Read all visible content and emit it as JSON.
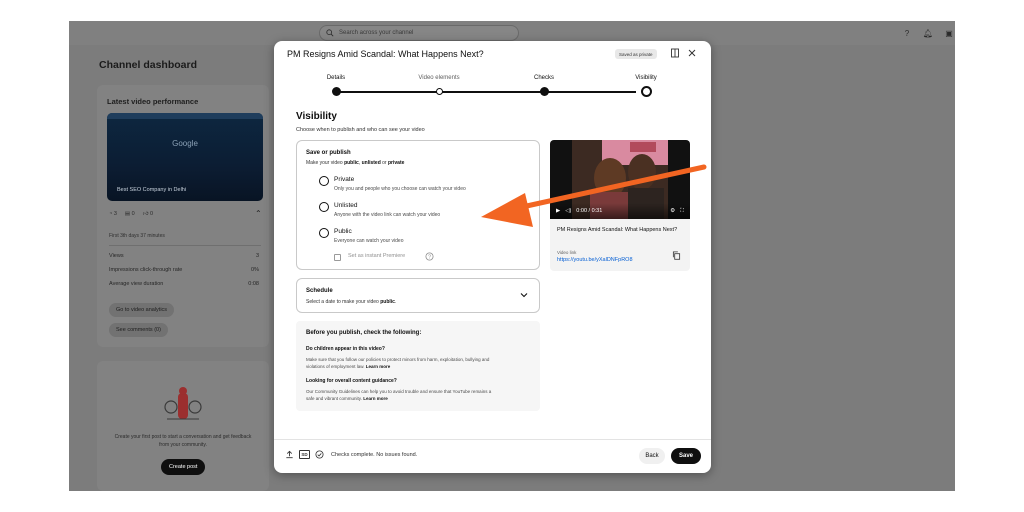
{
  "search": {
    "placeholder": "Search across your channel"
  },
  "dashboard": {
    "title": "Channel dashboard",
    "latest_card": {
      "title": "Latest video performance",
      "thumbnail_logo": "Google",
      "thumbnail_caption": "Best SEO Company in Delhi",
      "stats": [
        "3",
        "0",
        "0"
      ],
      "first_period": "First 3th days 37 minutes",
      "metrics": [
        {
          "label": "Views",
          "value": "3"
        },
        {
          "label": "Impressions click-through rate",
          "value": "0%"
        },
        {
          "label": "Average view duration",
          "value": "0:08"
        }
      ],
      "analytics_button": "Go to video analytics",
      "comments_button": "See comments (0)"
    },
    "post_card": {
      "text": "Create your first post to start a conversation and get feedback from your community.",
      "button": "Create post"
    }
  },
  "modal": {
    "title": "PM Resigns Amid Scandal: What Happens Next?",
    "saved_badge": "Saved as private",
    "steps": [
      {
        "label": "Details",
        "state": "done"
      },
      {
        "label": "Video elements",
        "state": "todo"
      },
      {
        "label": "Checks",
        "state": "done"
      },
      {
        "label": "Visibility",
        "state": "current"
      }
    ],
    "visibility_title": "Visibility",
    "visibility_sub": "Choose when to publish and who can see your video",
    "save_publish": {
      "heading": "Save or publish",
      "sub_prefix": "Make your video ",
      "sub_bold1": "public",
      "sub_sep1": ", ",
      "sub_bold2": "unlisted",
      "sub_sep2": " or ",
      "sub_bold3": "private",
      "options": [
        {
          "label": "Private",
          "desc": "Only you and people who you choose can watch your video"
        },
        {
          "label": "Unlisted",
          "desc": "Anyone with the video link can watch your video"
        },
        {
          "label": "Public",
          "desc": "Everyone can watch your video"
        }
      ],
      "premiere_label": "Set as instant Premiere"
    },
    "schedule": {
      "heading": "Schedule",
      "sub_prefix": "Select a date to make your video ",
      "sub_bold": "public",
      "sub_suffix": "."
    },
    "before_publish": {
      "heading": "Before you publish, check the following:",
      "q1": "Do children appear in this video?",
      "p1": "Make sure that you follow our policies to protect minors from harm, exploitation, bullying and violations of employment law.",
      "q2": "Looking for overall content guidance?",
      "p2": "Our Community Guidelines can help you to avoid trouble and ensure that YouTube remains a safe and vibrant community.",
      "learn_more": "Learn more"
    },
    "preview": {
      "time": "0:00 / 0:31",
      "video_title": "PM Resigns Amid Scandal: What Happens Next?",
      "link_label": "Video link",
      "link": "https://youtu.be/yXalDNFpRO8"
    },
    "footer": {
      "hd_badge": "SD",
      "status": "Checks complete. No issues found.",
      "back": "Back",
      "save": "Save"
    }
  },
  "colors": {
    "backdrop": "#7c7c7c",
    "primary": "#0f0f0f",
    "link": "#065fd4",
    "annotation_arrow": "#f26522"
  },
  "icons": [
    "search-icon",
    "help-icon",
    "bell-icon",
    "create-icon",
    "feedback-icon",
    "close-icon",
    "chevron-down-icon",
    "copy-icon",
    "play-icon",
    "settings-icon",
    "fullscreen-icon",
    "upload-icon",
    "check-circle-icon"
  ]
}
